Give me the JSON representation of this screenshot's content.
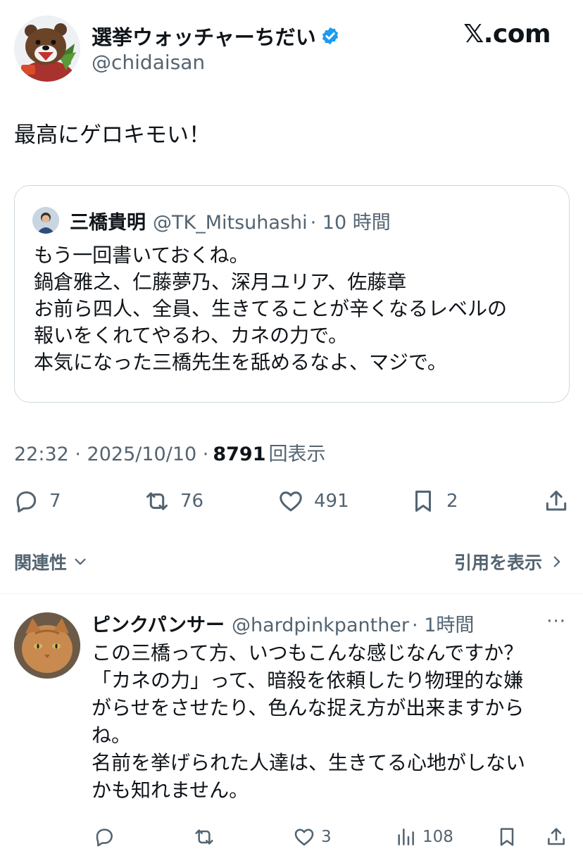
{
  "author": {
    "display_name": "選挙ウォッチャーちだい",
    "handle": "@chidaisan",
    "verified": true
  },
  "site_label": "𝕏.com",
  "post": {
    "text": "最高にゲロキモい！"
  },
  "quote": {
    "display_name": "三橋貴明",
    "handle": "@TK_Mitsuhashi",
    "time": "· 10 時間",
    "lines": [
      "もう一回書いておくね。",
      "鍋倉雅之、仁藤夢乃、深月ユリア、佐藤章",
      "お前ら四人、全員、生きてることが辛くなるレベルの",
      "報いをくれてやるわ、カネの力で。",
      "本気になった三橋先生を舐めるなよ、マジで。"
    ]
  },
  "meta": {
    "datetime": "22:32 · 2025/10/10 ·",
    "views_count": "8791",
    "views_label": "回表示"
  },
  "actions": {
    "replies": "7",
    "reposts": "76",
    "likes": "491",
    "bookmarks": "2"
  },
  "related_label": "関連性",
  "quotes_link_label": "引用を表示",
  "reply": {
    "display_name": "ピンクパンサー",
    "handle": "@hardpinkpanther",
    "time": "· 1時間",
    "more": "···",
    "lines": [
      "この三橋って方、いつもこんな感じなんですか？",
      "「カネの力」って、暗殺を依頼したり物理的な嫌",
      "がらせをさせたり、色んな捉え方が出来ますから",
      "ね。",
      "名前を挙げられた人達は、生きてる心地がしない",
      "かも知れません。"
    ],
    "actions": {
      "likes": "3",
      "views": "108"
    }
  },
  "colors": {
    "text": "#0f1419",
    "secondary": "#536471",
    "verified": "#1d9bf0",
    "border": "#cfd9de"
  }
}
